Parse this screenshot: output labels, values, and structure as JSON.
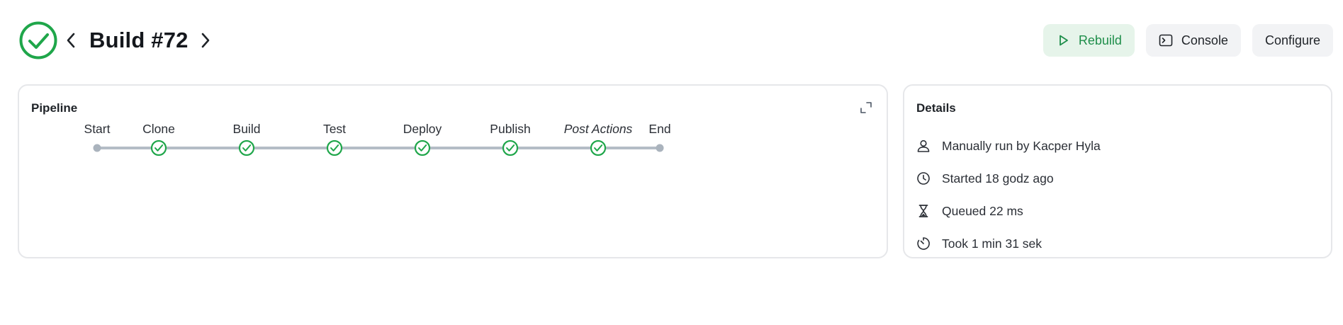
{
  "header": {
    "title": "Build #72",
    "status": "success",
    "prev_icon": "chevron-left-icon",
    "next_icon": "chevron-right-icon"
  },
  "actions": [
    {
      "label": "Rebuild",
      "icon": "play-icon",
      "accent": "#1e8e4a"
    },
    {
      "label": "Console",
      "icon": "terminal-icon"
    },
    {
      "label": "Configure"
    }
  ],
  "pipeline": {
    "title": "Pipeline",
    "expand_icon": "expand-icon",
    "stages": [
      {
        "label": "Start",
        "kind": "endpoint"
      },
      {
        "label": "Clone",
        "kind": "success"
      },
      {
        "label": "Build",
        "kind": "success"
      },
      {
        "label": "Test",
        "kind": "success"
      },
      {
        "label": "Deploy",
        "kind": "success"
      },
      {
        "label": "Publish",
        "kind": "success"
      },
      {
        "label": "Post Actions",
        "kind": "success",
        "italic": true
      },
      {
        "label": "End",
        "kind": "endpoint"
      }
    ]
  },
  "details": {
    "title": "Details",
    "items": [
      {
        "icon": "user-icon",
        "text": "Manually run by Kacper Hyla"
      },
      {
        "icon": "clock-icon",
        "text": "Started 18 godz ago"
      },
      {
        "icon": "hourglass-icon",
        "text": "Queued 22 ms"
      },
      {
        "icon": "timer-icon",
        "text": "Took 1 min 31 sek"
      }
    ]
  },
  "colors": {
    "success": "#1fa64a",
    "connector": "#b4bcc6",
    "endpoint": "#aab3bd",
    "rebuild_bg": "#e6f4ea"
  }
}
